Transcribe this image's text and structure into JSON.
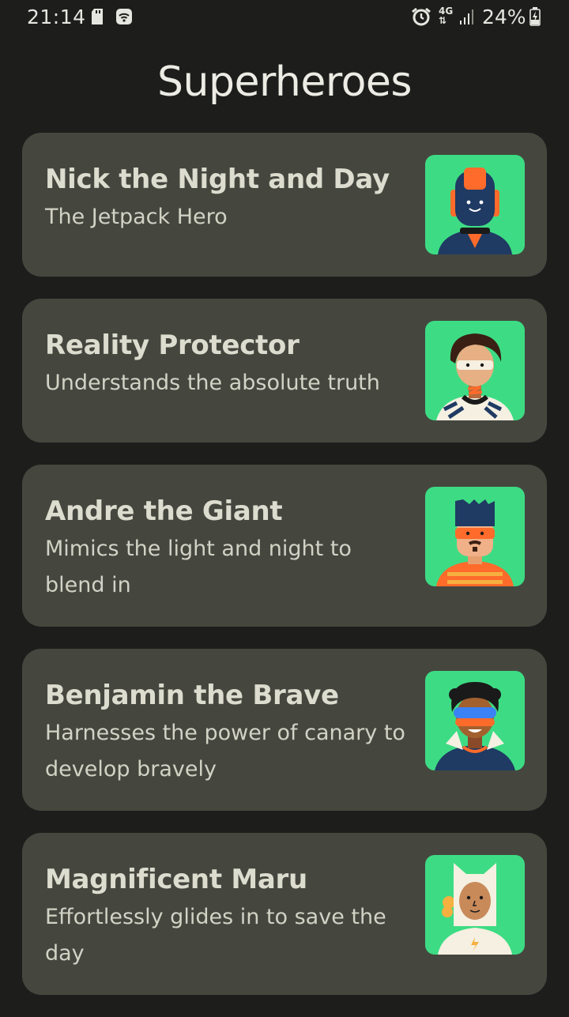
{
  "status_bar": {
    "time": "21:14",
    "network": "4G",
    "battery": "24%",
    "icons": [
      "sd-card-icon",
      "wifi-icon",
      "alarm-icon",
      "network-4g-icon",
      "signal-icon",
      "battery-charging-icon"
    ]
  },
  "title": "Superheroes",
  "colors": {
    "background": "#1d1e1b",
    "card": "#45473f",
    "avatar_bg": "#3ddc84",
    "title_text": "#ecebe4",
    "name_text": "#dcdccf"
  },
  "heroes": [
    {
      "name": "Nick the Night and Day",
      "description": "The Jetpack Hero",
      "avatar": "robot-hero-avatar"
    },
    {
      "name": "Reality Protector",
      "description": "Understands the absolute truth",
      "avatar": "curly-hair-hero-avatar"
    },
    {
      "name": "Andre the Giant",
      "description": "Mimics the light and night to blend in",
      "avatar": "masked-hero-avatar"
    },
    {
      "name": "Benjamin the Brave",
      "description": "Harnesses the power of canary to develop bravely",
      "avatar": "goggles-hero-avatar"
    },
    {
      "name": "Magnificent Maru",
      "description": "Effortlessly glides in to save the day",
      "avatar": "cat-hood-hero-avatar"
    }
  ]
}
